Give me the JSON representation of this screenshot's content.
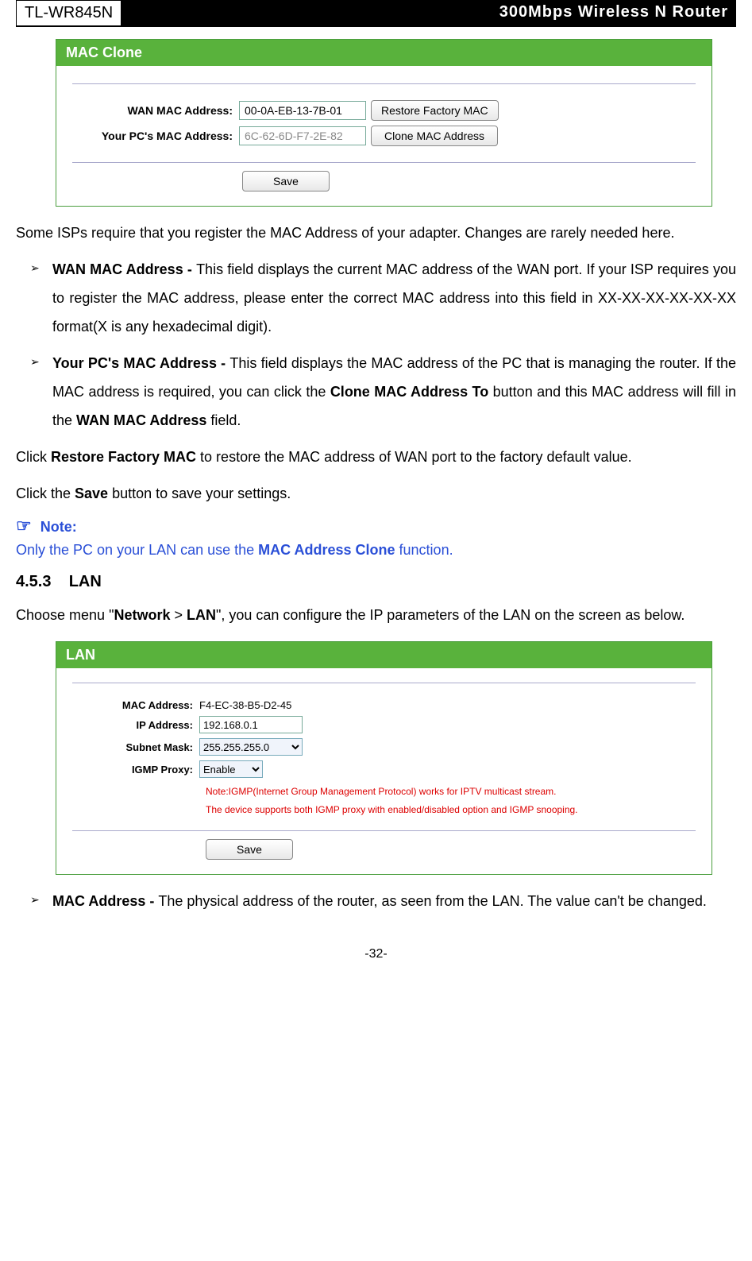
{
  "header": {
    "model": "TL-WR845N",
    "product": "300Mbps Wireless N Router"
  },
  "mac_clone_panel": {
    "title": "MAC Clone",
    "wan_label": "WAN MAC Address:",
    "wan_value": "00-0A-EB-13-7B-01",
    "restore_btn": "Restore Factory MAC",
    "pc_label": "Your PC's MAC Address:",
    "pc_value": "6C-62-6D-F7-2E-82",
    "clone_btn": "Clone MAC Address",
    "save_btn": "Save"
  },
  "para_intro": "Some ISPs require that you register the MAC Address of your adapter. Changes are rarely needed here.",
  "bullet_wan": {
    "title": "WAN MAC Address - ",
    "text": "This field displays the current MAC address of the WAN port. If your ISP requires you to register the MAC address, please enter the correct MAC address into this field in XX-XX-XX-XX-XX-XX format(X is any hexadecimal digit)."
  },
  "bullet_pc": {
    "title": "Your PC's MAC Address - ",
    "text_a": "This field displays the MAC address of the PC that is managing the router. If the MAC address is required, you can click the ",
    "bold_a": "Clone MAC Address To",
    "text_b": " button and this MAC address will fill in the ",
    "bold_b": "WAN MAC Address",
    "text_c": " field."
  },
  "para_restore_a": "Click ",
  "para_restore_bold": "Restore Factory MAC",
  "para_restore_b": " to restore the MAC address of WAN port to the factory default value.",
  "para_save_a": "Click the ",
  "para_save_bold": "Save",
  "para_save_b": " button to save your settings.",
  "note": {
    "icon": "☞",
    "label": " Note:",
    "text_a": "Only the PC on your LAN can use the ",
    "bold": "MAC Address Clone",
    "text_b": " function."
  },
  "section_lan": {
    "number": "4.5.3",
    "title": "LAN"
  },
  "para_lan_a": "Choose menu \"",
  "para_lan_bold_a": "Network",
  "para_lan_gt": " > ",
  "para_lan_bold_b": "LAN",
  "para_lan_b": "\", you can configure the IP parameters of the LAN on the screen as below.",
  "lan_panel": {
    "title": "LAN",
    "mac_label": "MAC Address:",
    "mac_value": "F4-EC-38-B5-D2-45",
    "ip_label": "IP Address:",
    "ip_value": "192.168.0.1",
    "subnet_label": "Subnet Mask:",
    "subnet_value": "255.255.255.0",
    "igmp_label": "IGMP Proxy:",
    "igmp_value": "Enable",
    "note1": "Note:IGMP(Internet Group Management Protocol) works for IPTV multicast stream.",
    "note2": "The device supports both IGMP proxy with enabled/disabled option and IGMP snooping.",
    "save_btn": "Save"
  },
  "bullet_mac": {
    "title": "MAC Address - ",
    "text": "The physical address of the router, as seen from the LAN. The value can't be changed."
  },
  "page_number": "-32-"
}
